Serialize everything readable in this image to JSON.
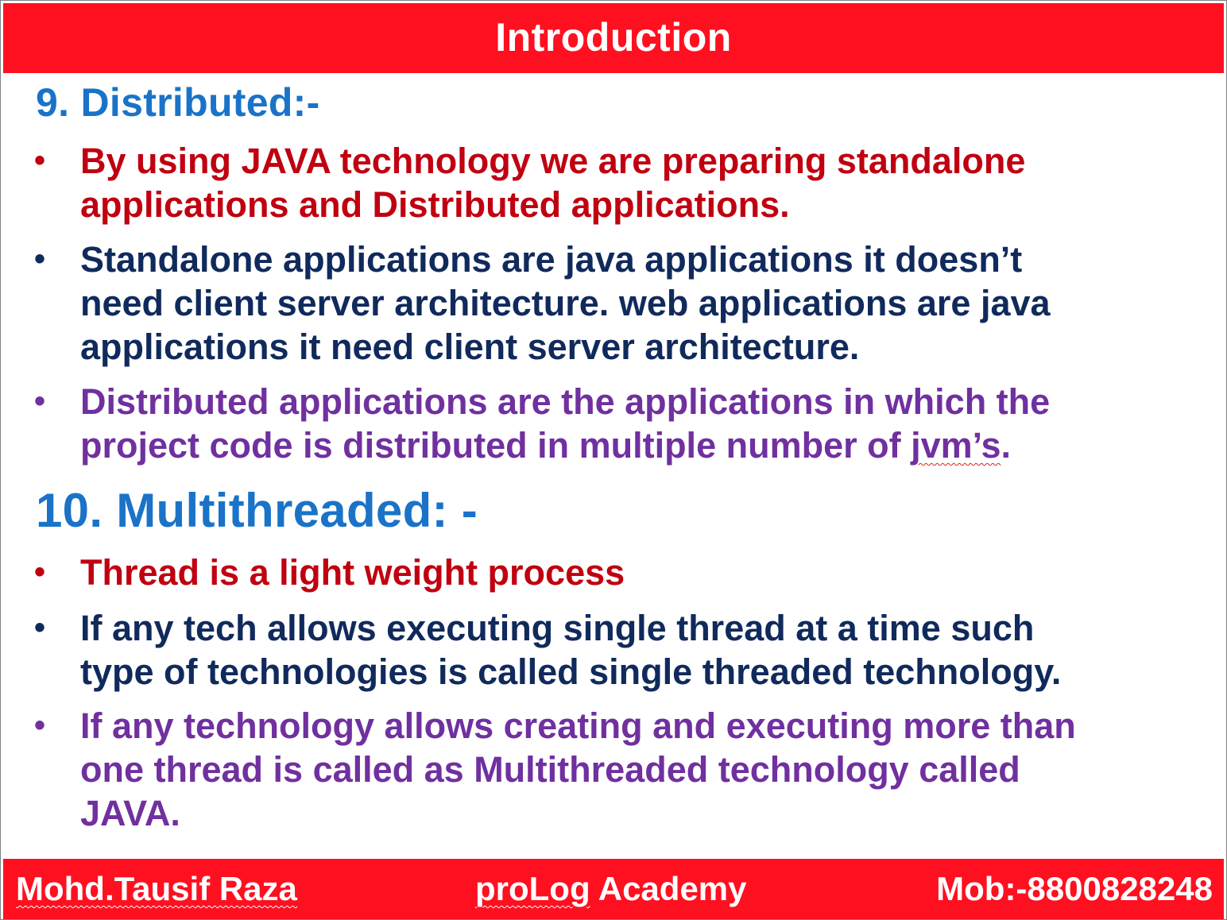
{
  "header": {
    "title": "Introduction"
  },
  "section_9": {
    "heading": "9. Distributed:-",
    "bullets": [
      {
        "marker": "•",
        "text": "By using JAVA technology we are preparing standalone\napplications and Distributed applications."
      },
      {
        "marker": "•",
        "text": "Standalone applications are java applications it doesn’t\nneed client server architecture. web applications are java\napplications it need client server architecture."
      },
      {
        "marker": "•",
        "text_before": "Distributed applications are the applications in which the\nproject code is distributed in multiple number of ",
        "text_flagged": "jvm’s",
        "text_after": "."
      }
    ]
  },
  "section_10": {
    "heading": "10. Multithreaded: -",
    "bullets": [
      {
        "marker": "•",
        "text": "Thread is a light weight process"
      },
      {
        "marker": "•",
        "text": "If any tech allows executing single thread at a time such\ntype of technologies is called single threaded technology."
      },
      {
        "marker": "•",
        "text": "If any technology allows creating and executing more than\none thread is called as Multithreaded technology called\nJAVA."
      }
    ]
  },
  "footer": {
    "author": "Mohd.Tausif Raza",
    "academy_prefix": "proLog",
    "academy_suffix": " Academy",
    "mobile": "Mob:-8800828248"
  },
  "colors": {
    "bar": "#ff1020",
    "heading": "#1a73c8",
    "red_text": "#c00010",
    "navy_text": "#102a5c",
    "purple_text": "#7030a0"
  }
}
